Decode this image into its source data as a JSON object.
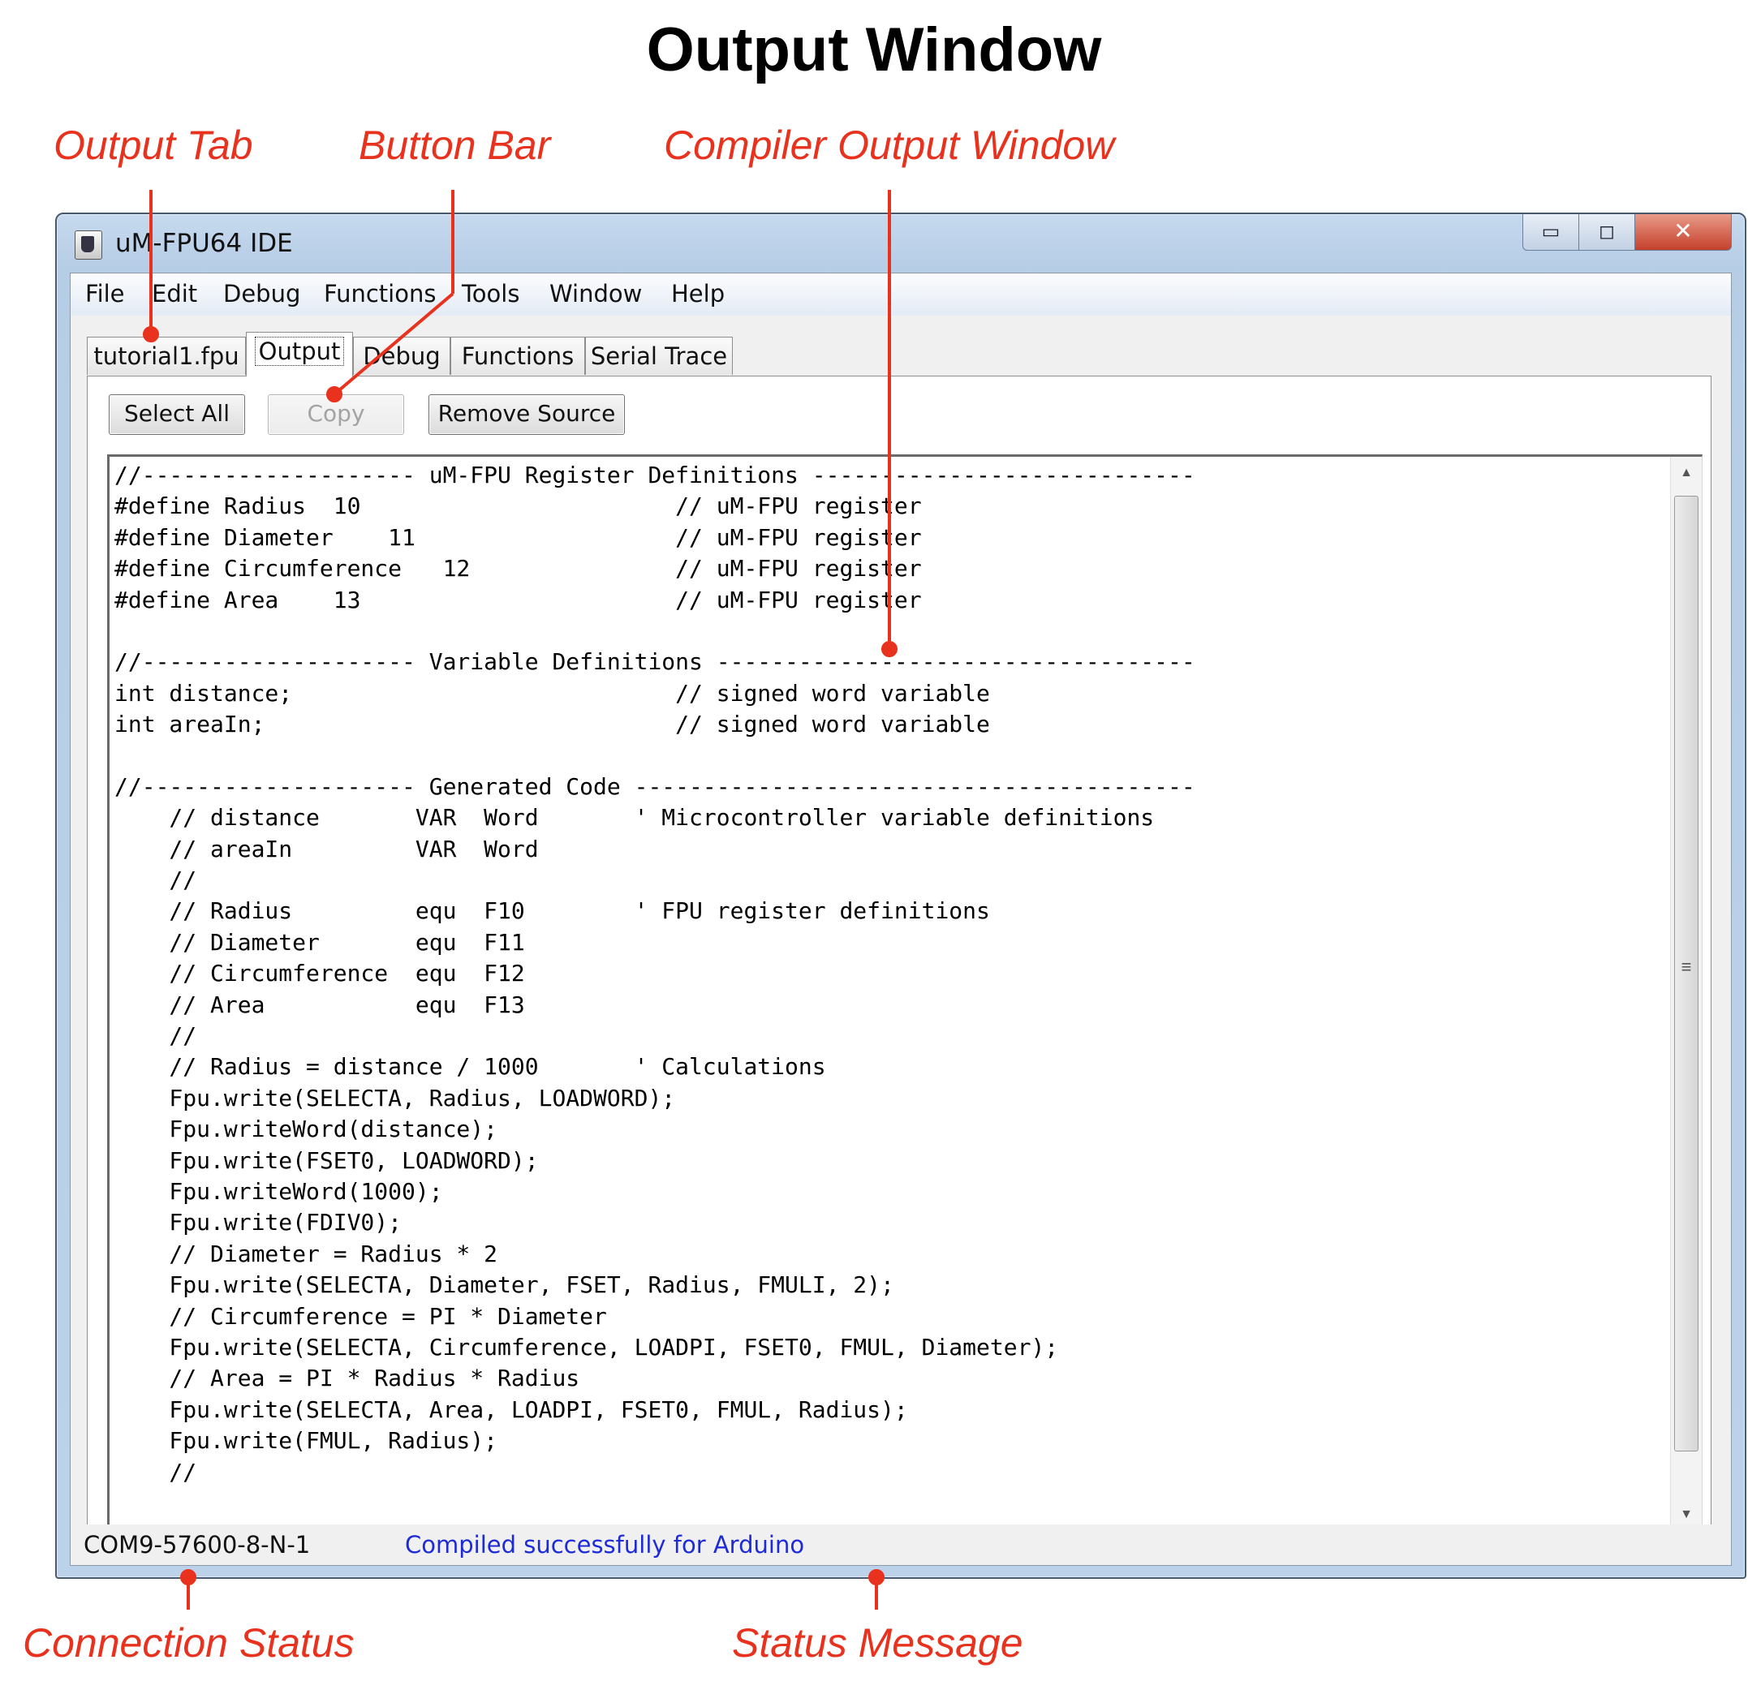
{
  "page_title": "Output Window",
  "callouts": {
    "output_tab": "Output Tab",
    "button_bar": "Button Bar",
    "compiler_output_window": "Compiler Output Window",
    "connection_status": "Connection Status",
    "status_message": "Status Message"
  },
  "colors": {
    "callout": "#e8321e",
    "status_message": "#1d2bd6"
  },
  "window": {
    "title": "uM-FPU64 IDE",
    "app_icon": "um-fpu-ide-icon",
    "controls": {
      "minimize": "▭",
      "maximize": "◻",
      "close": "✕"
    }
  },
  "menu": {
    "items": [
      {
        "label": "File"
      },
      {
        "label": "Edit"
      },
      {
        "label": "Debug"
      },
      {
        "label": "Functions"
      },
      {
        "label": "Tools"
      },
      {
        "label": "Window"
      },
      {
        "label": "Help"
      }
    ]
  },
  "tabs": [
    {
      "label": "tutorial1.fpu"
    },
    {
      "label": "Output",
      "active": true
    },
    {
      "label": "Debug"
    },
    {
      "label": "Functions"
    },
    {
      "label": "Serial Trace"
    }
  ],
  "buttons": {
    "select_all": "Select All",
    "copy": "Copy",
    "copy_enabled": false,
    "remove_source": "Remove Source"
  },
  "code_lines": [
    "//-------------------- uM-FPU Register Definitions ----------------------------",
    "#define Radius  10                       // uM-FPU register",
    "#define Diameter    11                   // uM-FPU register",
    "#define Circumference   12               // uM-FPU register",
    "#define Area    13                       // uM-FPU register",
    "",
    "//-------------------- Variable Definitions -----------------------------------",
    "int distance;                            // signed word variable",
    "int areaIn;                              // signed word variable",
    "",
    "//-------------------- Generated Code -----------------------------------------",
    "    // distance       VAR  Word       ' Microcontroller variable definitions",
    "    // areaIn         VAR  Word",
    "    //",
    "    // Radius         equ  F10        ' FPU register definitions",
    "    // Diameter       equ  F11",
    "    // Circumference  equ  F12",
    "    // Area           equ  F13",
    "    //",
    "    // Radius = distance / 1000       ' Calculations",
    "    Fpu.write(SELECTA, Radius, LOADWORD);",
    "    Fpu.writeWord(distance);",
    "    Fpu.write(FSET0, LOADWORD);",
    "    Fpu.writeWord(1000);",
    "    Fpu.write(FDIV0);",
    "    // Diameter = Radius * 2",
    "    Fpu.write(SELECTA, Diameter, FSET, Radius, FMULI, 2);",
    "    // Circumference = PI * Diameter",
    "    Fpu.write(SELECTA, Circumference, LOADPI, FSET0, FMUL, Diameter);",
    "    // Area = PI * Radius * Radius",
    "    Fpu.write(SELECTA, Area, LOADPI, FSET0, FMUL, Radius);",
    "    Fpu.write(FMUL, Radius);",
    "    //"
  ],
  "scrollbar": {
    "up": "▲",
    "down": "▼",
    "grip": "≡"
  },
  "status": {
    "connection": "COM9-57600-8-N-1",
    "message": "Compiled successfully for Arduino"
  }
}
